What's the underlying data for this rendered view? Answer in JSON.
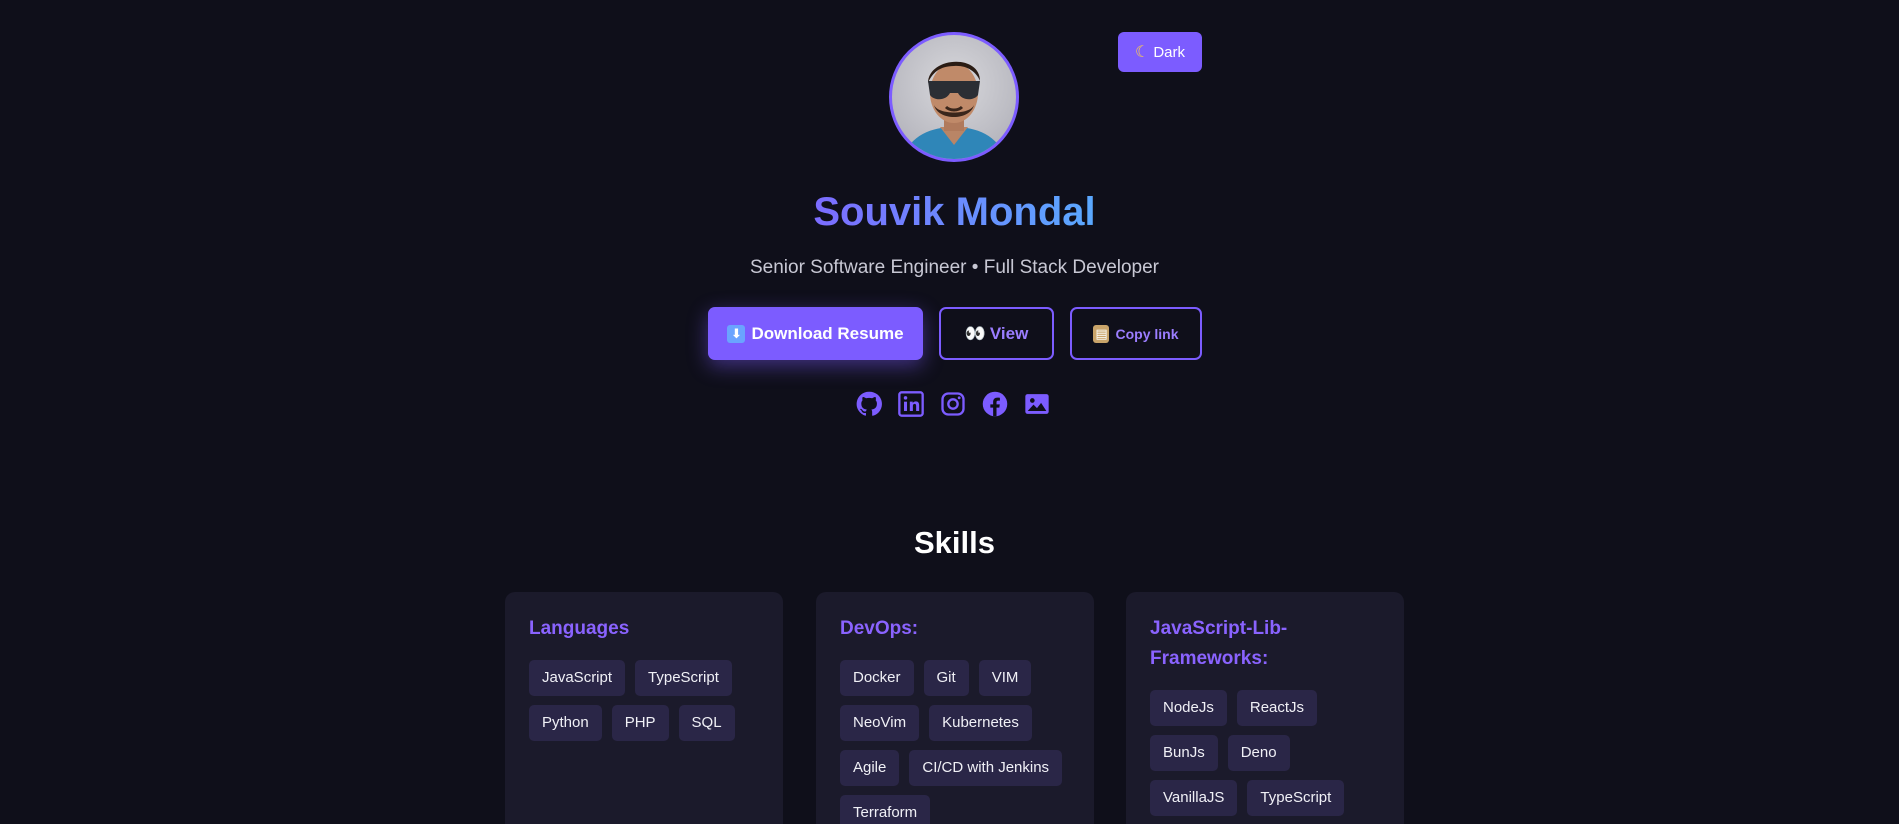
{
  "theme_toggle": {
    "icon": "moon-icon",
    "label": "Dark"
  },
  "profile": {
    "name": "Souvik Mondal",
    "subtitle": "Senior Software Engineer • Full Stack Developer",
    "avatar": "profile-photo"
  },
  "actions": {
    "download_label": "Download Resume",
    "view_label": "View",
    "copy_label": "Copy link"
  },
  "socials": [
    "github-icon",
    "linkedin-icon",
    "instagram-icon",
    "facebook-icon",
    "image-icon"
  ],
  "skills": {
    "title": "Skills",
    "cards": [
      {
        "title": "Languages",
        "tags": [
          "JavaScript",
          "TypeScript",
          "Python",
          "PHP",
          "SQL"
        ]
      },
      {
        "title": "DevOps:",
        "tags": [
          "Docker",
          "Git",
          "VIM",
          "NeoVim",
          "Kubernetes",
          "Agile",
          "CI/CD with Jenkins",
          "Terraform"
        ]
      },
      {
        "title": "JavaScript-Lib-Frameworks:",
        "tags": [
          "NodeJs",
          "ReactJs",
          "BunJs",
          "Deno",
          "VanillaJS",
          "TypeScript"
        ]
      }
    ]
  },
  "colors": {
    "accent": "#7c5cff",
    "background": "#0f0f1a",
    "card": "#1b1a2b",
    "tag": "#2a2647"
  }
}
